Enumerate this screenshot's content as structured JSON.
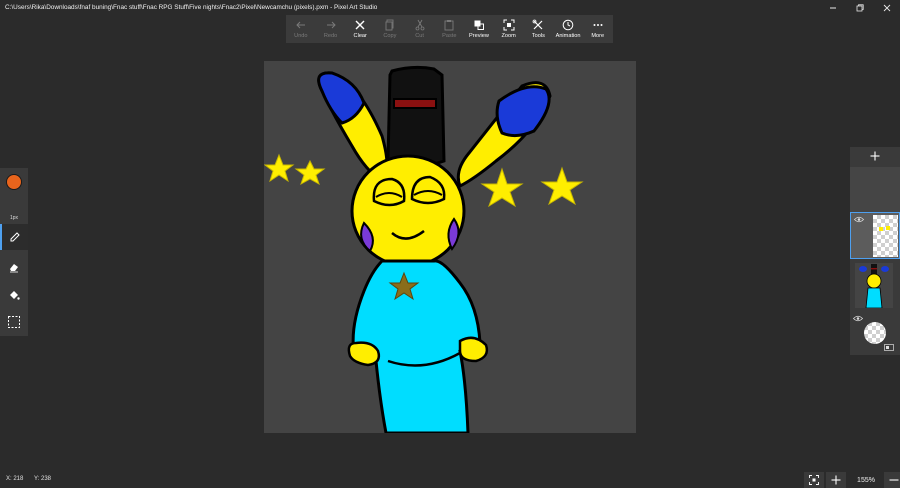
{
  "window": {
    "title": "C:\\Users\\Rika\\Downloads\\fnaf buning\\Fnac stuff\\Fnac RPG Stuff\\Five nights\\Fnac2\\Pixel\\Newcamchu (pixels).pxm - Pixel Art Studio",
    "controls": [
      "minimize",
      "maximize",
      "close"
    ]
  },
  "toolbar": {
    "items": [
      {
        "label": "Undo",
        "icon": "arrow-left-icon",
        "enabled": false
      },
      {
        "label": "Redo",
        "icon": "arrow-right-icon",
        "enabled": false
      },
      {
        "label": "Clear",
        "icon": "x-icon",
        "enabled": true
      },
      {
        "label": "Copy",
        "icon": "copy-icon",
        "enabled": false
      },
      {
        "label": "Cut",
        "icon": "scissors-icon",
        "enabled": false
      },
      {
        "label": "Paste",
        "icon": "paste-icon",
        "enabled": false
      },
      {
        "label": "Preview",
        "icon": "preview-icon",
        "enabled": true
      },
      {
        "label": "Zoom",
        "icon": "zoom-icon",
        "enabled": true
      },
      {
        "label": "Tools",
        "icon": "tools-icon",
        "enabled": true
      },
      {
        "label": "Animation",
        "icon": "clock-icon",
        "enabled": true
      },
      {
        "label": "More",
        "icon": "more-icon",
        "enabled": true
      }
    ]
  },
  "left_tools": {
    "current_color": "#e8641c",
    "brush_size": "1px",
    "tools": [
      "pencil-icon",
      "eraser-icon",
      "fill-bucket-icon",
      "selection-icon"
    ],
    "active_tool": "pencil-icon"
  },
  "layers": {
    "add_label": "+",
    "count_visible": 3
  },
  "status": {
    "x": "X: 218",
    "y": "Y: 238"
  },
  "zoom": {
    "level": "155%"
  },
  "colors": {
    "accent": "#4ea0f0",
    "canvas_bg": "#444444",
    "app_bg": "#2b2b2b"
  }
}
